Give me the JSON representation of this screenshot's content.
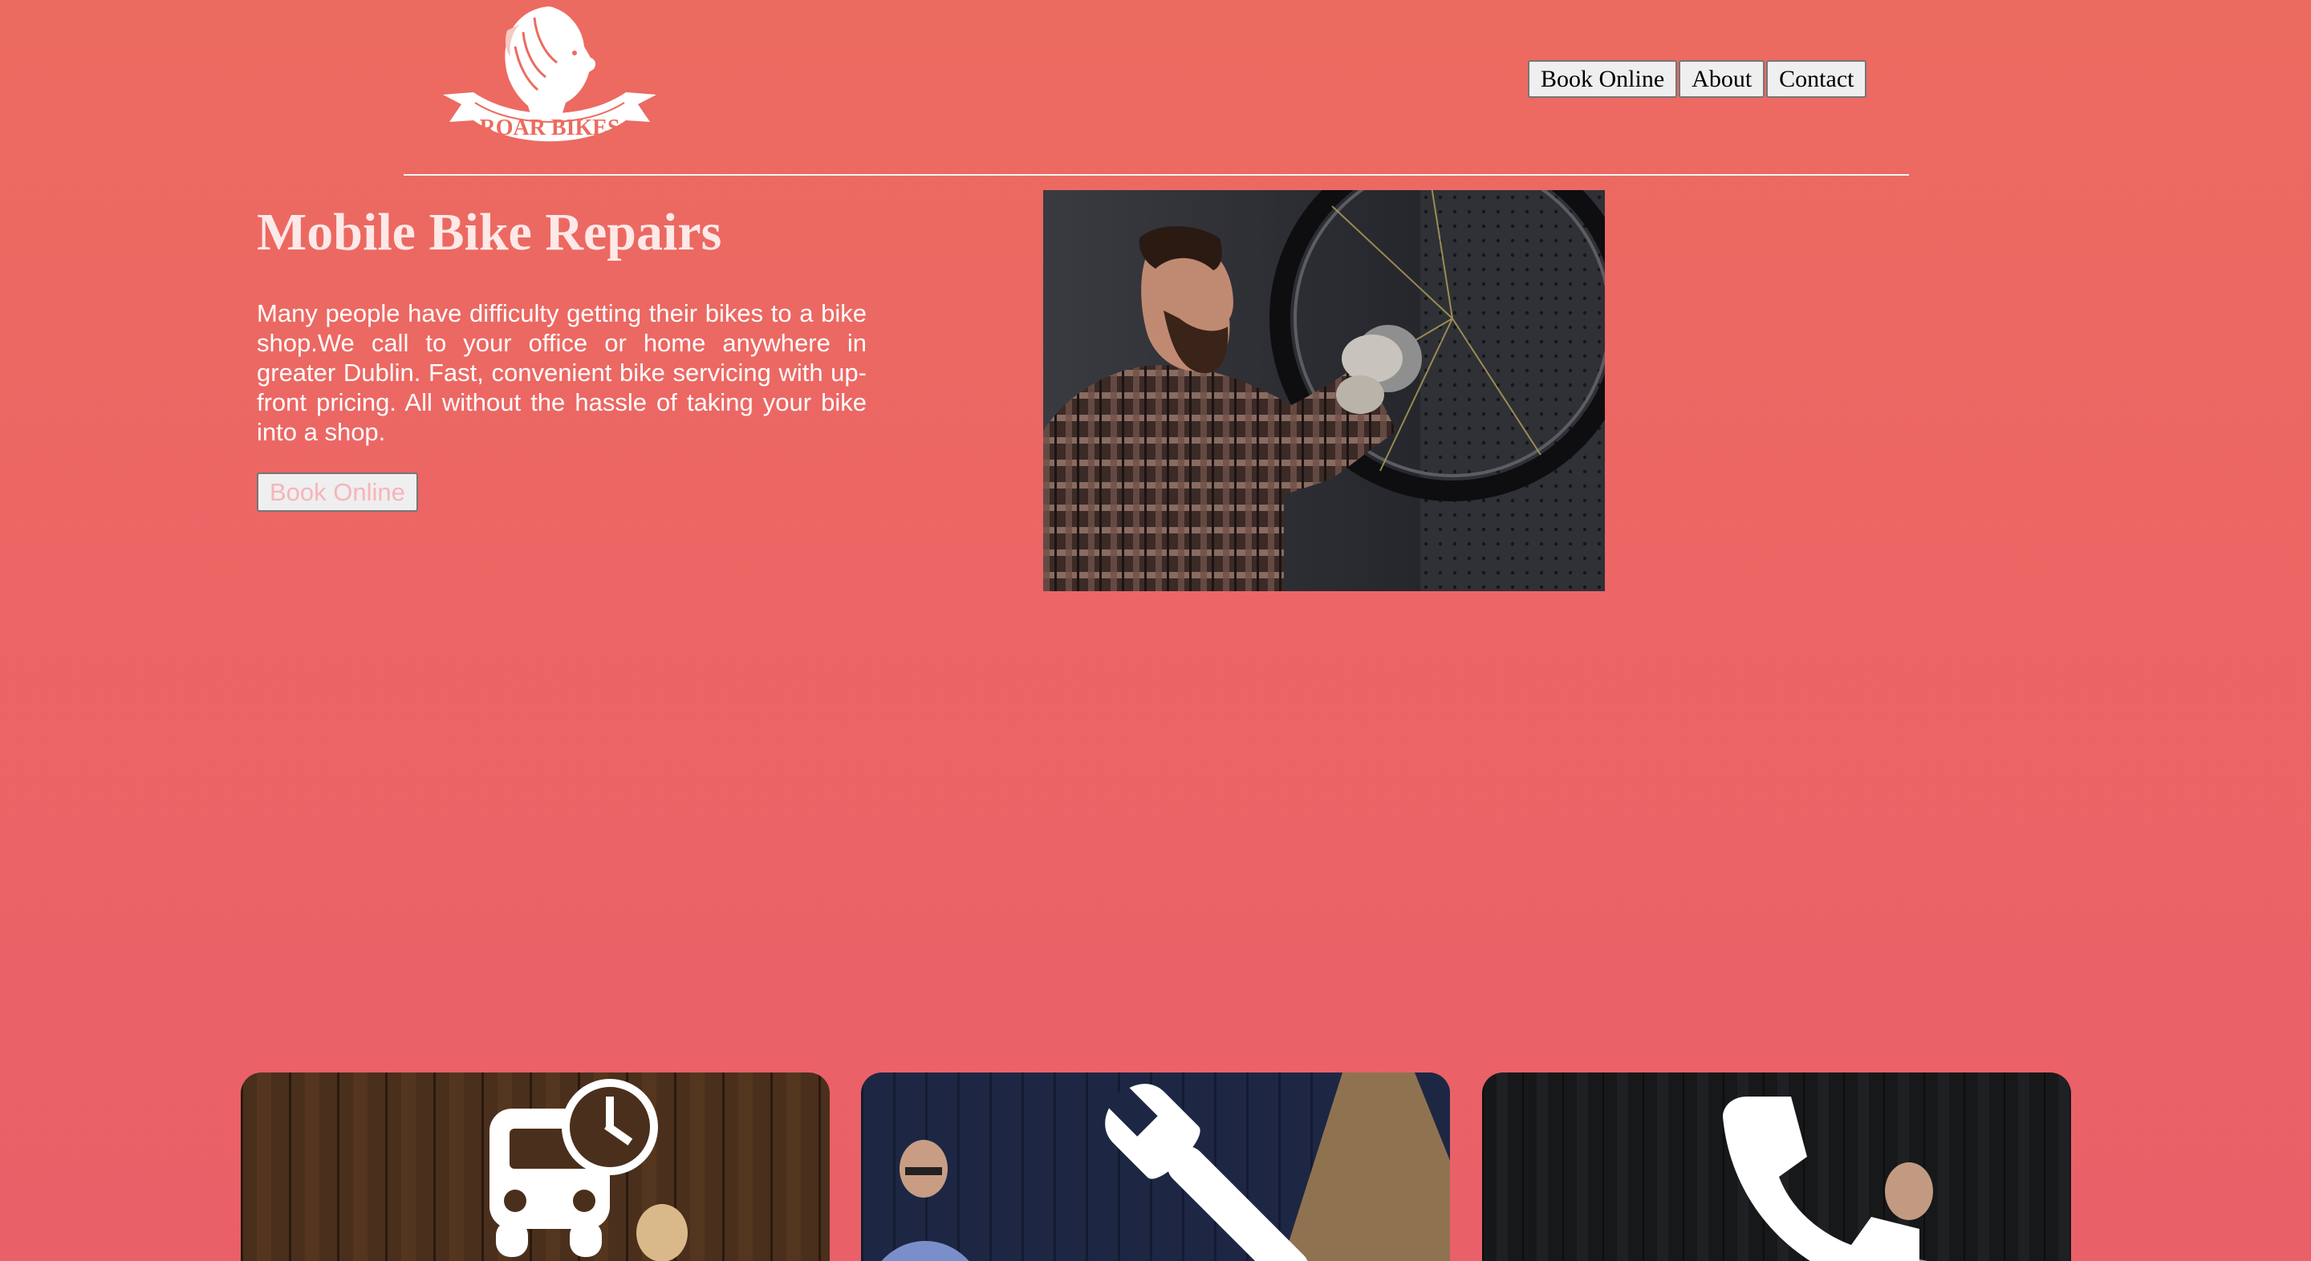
{
  "brand": {
    "logo_text": "ROAR BIKES",
    "logo_icon": "lion-head-icon"
  },
  "nav": {
    "items": [
      {
        "label": "Book Online"
      },
      {
        "label": "About"
      },
      {
        "label": "Contact"
      }
    ]
  },
  "hero": {
    "title": "Mobile Bike Repairs",
    "text": "Many people have difficulty getting their bikes to a bike shop.We call to your office or home anywhere in greater Dublin. Fast, convenient bike servicing with up-front pricing. All without the hassle of taking your bike into a shop.",
    "button_label": "Book Online",
    "image": "mechanic-repairing-bike-wheel-photo"
  },
  "features": [
    {
      "icon": "van-clock-icon",
      "image": "wood-panel-woman-photo"
    },
    {
      "icon": "wrench-icon",
      "image": "blue-wall-man-photo"
    },
    {
      "icon": "phone-icon",
      "image": "dark-wood-man-photo"
    }
  ],
  "colors": {
    "background_top": "#ec6b60",
    "background_bottom": "#e96068",
    "title": "#fde9e7",
    "text": "#ffffff",
    "button_text_muted": "#f7b4bb"
  }
}
